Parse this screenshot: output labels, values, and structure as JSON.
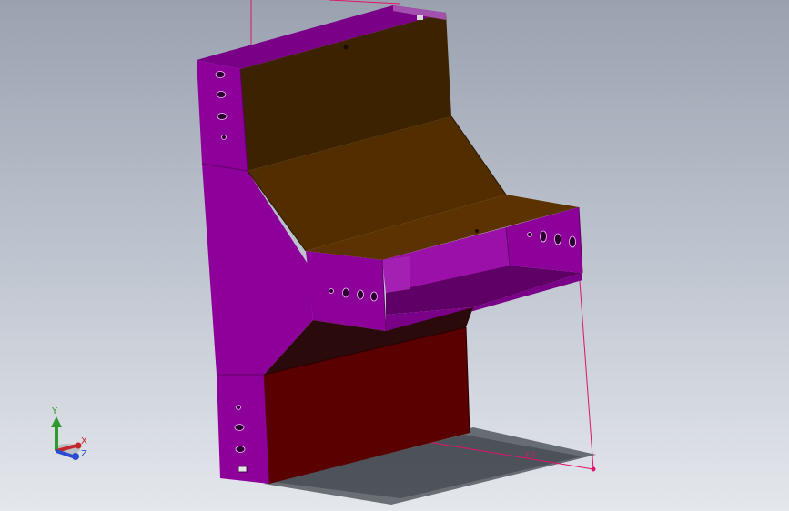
{
  "viewport": {
    "background_top": "#9aa2b0",
    "background_bottom": "#e4e7ec"
  },
  "model": {
    "colors": {
      "frame": "#8e009a",
      "frame_dark": "#5e0066",
      "panel_brown": "#3d2200",
      "panel_tan": "#522d00",
      "panel_red": "#5a0000",
      "sketch_line": "#e0136d"
    }
  },
  "triad": {
    "x_label": "X",
    "y_label": "Y",
    "z_label": "Z",
    "x_color": "#c0282d",
    "y_color": "#2e9a2e",
    "z_color": "#2b4bd1"
  },
  "dimension": {
    "label": "(-)"
  }
}
